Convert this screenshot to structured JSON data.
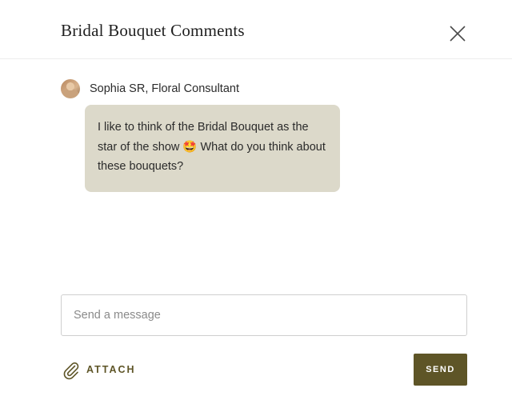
{
  "header": {
    "title": "Bridal Bouquet Comments",
    "close_icon": "close-icon"
  },
  "message": {
    "sender": "Sophia SR, Floral Consultant",
    "avatar": "avatar-photo",
    "text": "I like to think of the Bridal Bouquet as the star of the show 🤩 What do you think about these bouquets?"
  },
  "composer": {
    "placeholder": "Send a message",
    "value": ""
  },
  "actions": {
    "attach_label": "ATTACH",
    "attach_icon": "paperclip-icon",
    "send_label": "SEND"
  },
  "colors": {
    "accent": "#5e5527",
    "bubble": "#dcd9ca"
  }
}
